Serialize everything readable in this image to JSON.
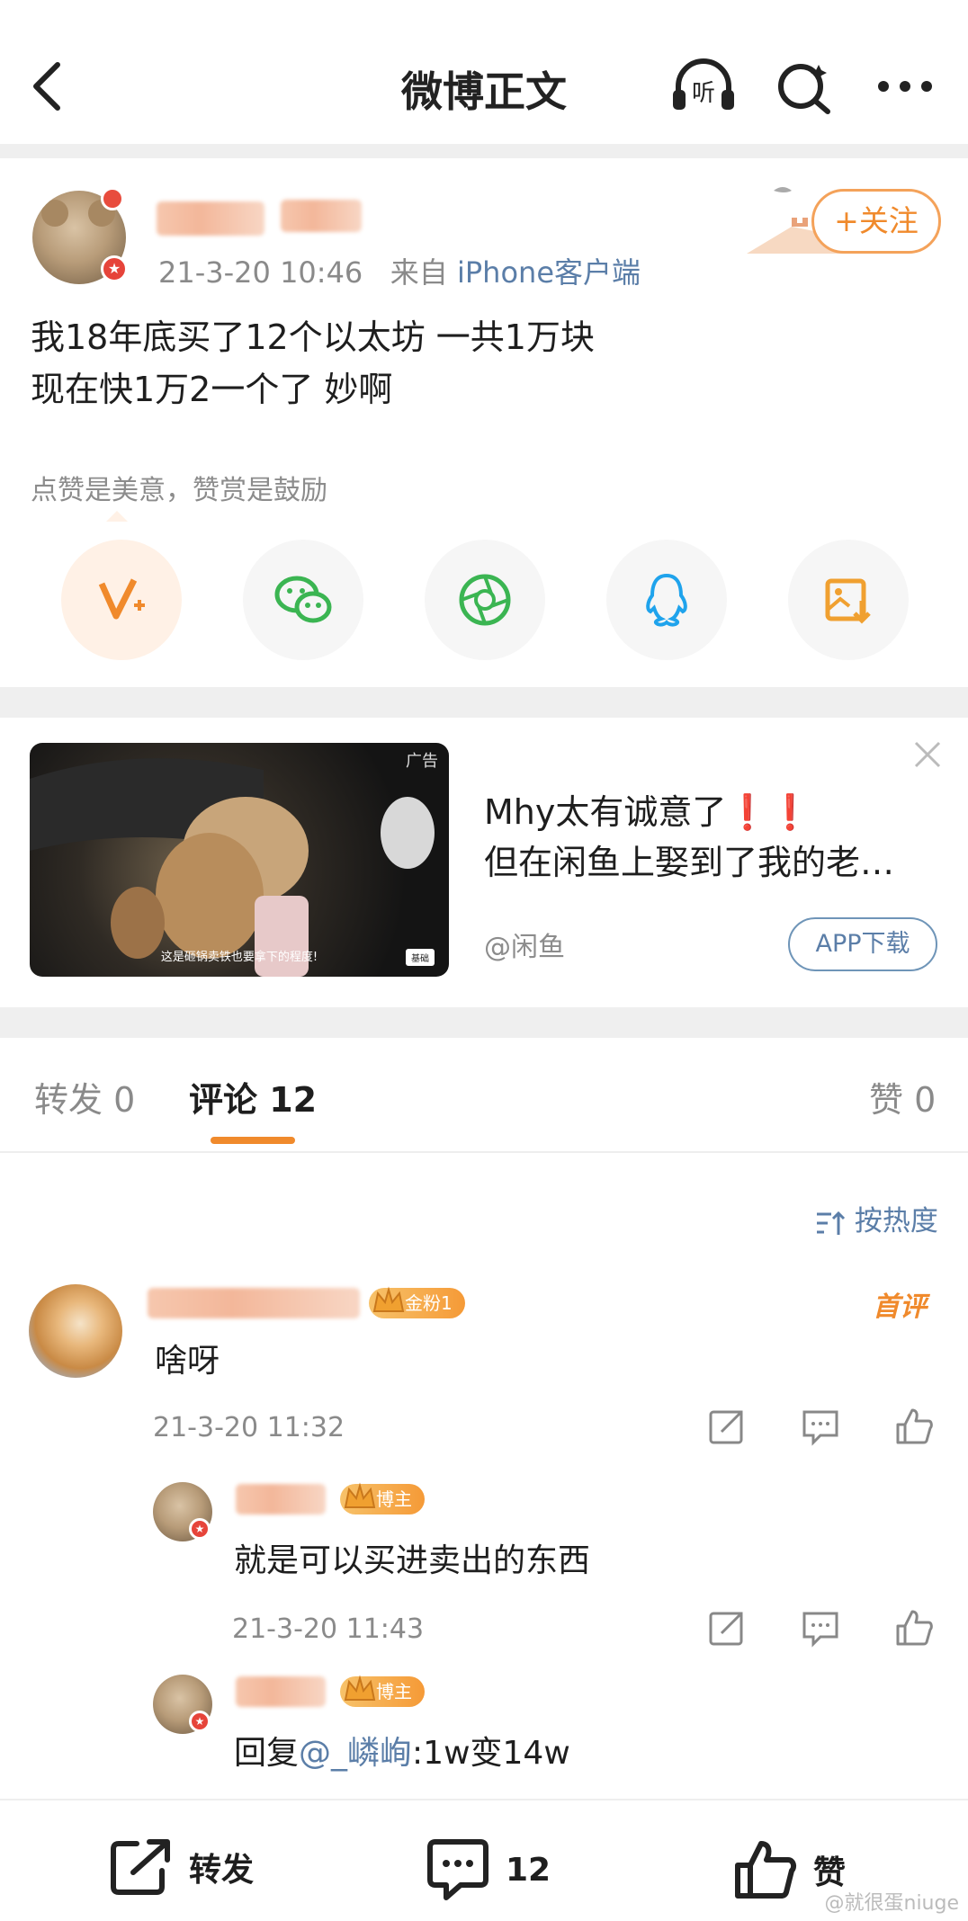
{
  "header": {
    "title": "微博正文"
  },
  "post": {
    "timestamp": "21-3-20 10:46",
    "source_prefix": "来自",
    "source": "iPhone客户端",
    "follow_label": "+关注",
    "content_line1": "我18年底买了12个以太坊 一共1万块",
    "content_line2": "现在快1万2一个了 妙啊",
    "reward_hint": "点赞是美意，赞赏是鼓励"
  },
  "ad": {
    "title_line1": "Mhy太有诚意了❗❗",
    "title_line2": "但在闲鱼上娶到了我的老…",
    "source": "@闲鱼",
    "download_label": "APP下载",
    "ad_tag": "广告",
    "video_caption": "这是砸锅卖铁也要拿下的程度!",
    "video_button": "基础"
  },
  "tabs": {
    "repost": "转发 0",
    "comments": "评论 12",
    "likes": "赞 0"
  },
  "sort_label": "按热度",
  "comments": [
    {
      "badge": "金粉1",
      "first_label": "首评",
      "text": "啥呀",
      "time": "21-3-20 11:32"
    },
    {
      "badge": "博主",
      "text": "就是可以买进卖出的东西",
      "time": "21-3-20 11:43"
    },
    {
      "badge": "博主",
      "reply_prefix": "回复",
      "reply_to": "@_嶙峋",
      "text": ":1w变14w"
    }
  ],
  "bottom": {
    "repost": "转发",
    "comment_count": "12",
    "like": "赞"
  },
  "watermark": "@就很蛋niuge",
  "colors": {
    "accent": "#f08a2c",
    "link": "#5b7ea8",
    "divider": "#efefef"
  }
}
